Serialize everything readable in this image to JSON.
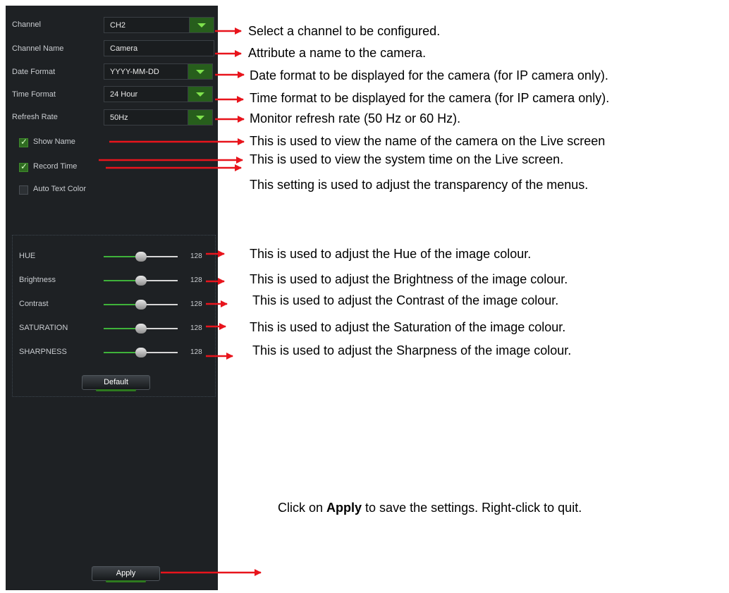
{
  "form": {
    "channel": {
      "label": "Channel",
      "value": "CH2"
    },
    "channel_name": {
      "label": "Channel Name",
      "value": "Camera"
    },
    "date_format": {
      "label": "Date Format",
      "value": "YYYY-MM-DD"
    },
    "time_format": {
      "label": "Time Format",
      "value": "24 Hour"
    },
    "refresh_rate": {
      "label": "Refresh Rate",
      "value": "50Hz"
    },
    "show_name": {
      "label": "Show Name",
      "checked": true
    },
    "record_time": {
      "label": "Record Time",
      "checked": true
    },
    "auto_text_color": {
      "label": "Auto Text Color",
      "checked": false
    }
  },
  "image": {
    "sliders": [
      {
        "label": "HUE",
        "value": "128",
        "level": 0.5
      },
      {
        "label": "Brightness",
        "value": "128",
        "level": 0.5
      },
      {
        "label": "Contrast",
        "value": "128",
        "level": 0.5
      },
      {
        "label": "SATURATION",
        "value": "128",
        "level": 0.5
      },
      {
        "label": "SHARPNESS",
        "value": "128",
        "level": 0.5
      }
    ],
    "default_button": "Default"
  },
  "apply_button": "Apply",
  "annotations": {
    "channel": "Select a channel to be configured.",
    "channel_name": "Attribute a name to the camera.",
    "date_format": "Date format to be displayed for the camera (for IP camera only).",
    "time_format": "Time format to be displayed for the camera (for IP camera only).",
    "refresh_rate": "Monitor refresh rate (50 Hz or 60 Hz).",
    "show_name": "This is used to view the name of the camera on the Live screen",
    "record_time": "This is used to view the system time on the Live screen.",
    "auto_text_color": "This setting is used to adjust the transparency of the menus.",
    "hue": "This is used to adjust the Hue of the image colour.",
    "brightness": "This is used to adjust the Brightness of the image colour.",
    "contrast": "This is used to adjust the Contrast of the image colour.",
    "saturation": "This is used to adjust the Saturation of the image colour.",
    "sharpness": "This is used to adjust the Sharpness of the image colour.",
    "apply_prefix": "Click on ",
    "apply_bold": "Apply",
    "apply_suffix": " to save the settings. Right-click to quit."
  },
  "colors": {
    "panel": "#1e2124",
    "accent_green": "#3fb23a",
    "arrow_red": "#e8141c"
  }
}
